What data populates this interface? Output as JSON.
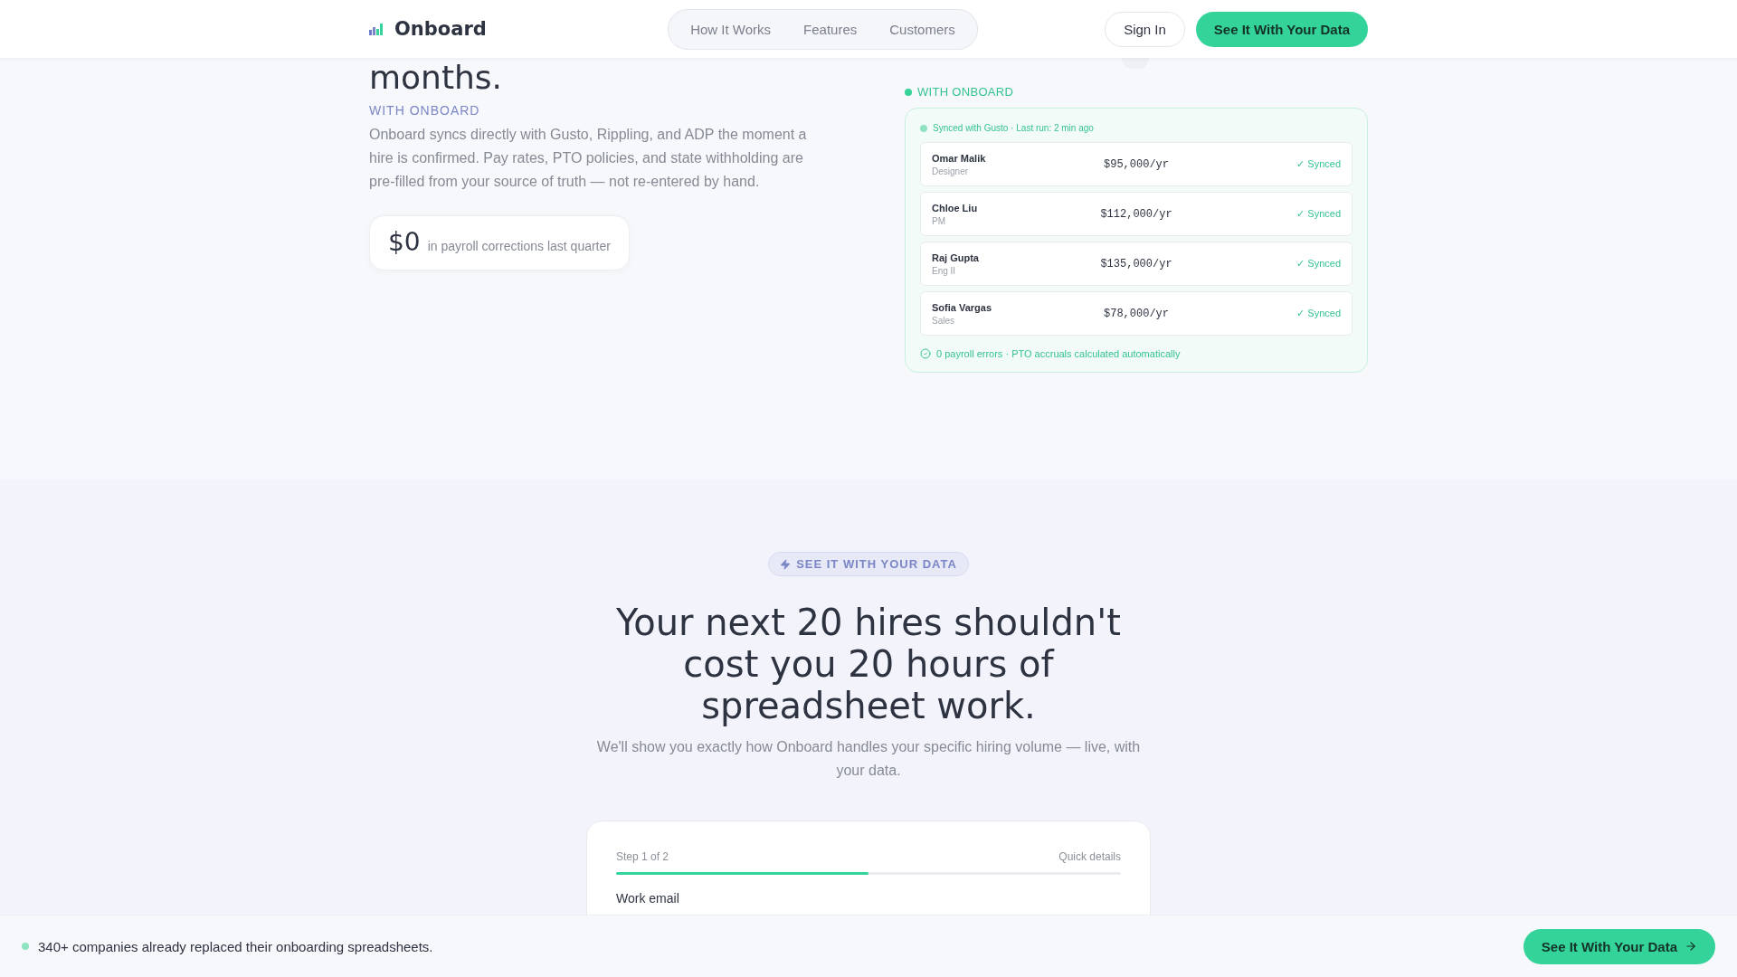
{
  "header": {
    "logo": "Onboard",
    "nav": [
      {
        "label": "How It Works"
      },
      {
        "label": "Features"
      },
      {
        "label": "Customers"
      }
    ],
    "sign_in": "Sign In",
    "cta": "See It With Your Data"
  },
  "comparison": {
    "heading_tail": "months.",
    "eyebrow": "WITH ONBOARD",
    "body": "Onboard syncs directly with Gusto, Rippling, and ADP the moment a hire is confirmed. Pay rates, PTO policies, and state withholding are pre-filled from your source of truth — not re-entered by hand.",
    "stat": {
      "value": "$0",
      "label": "in payroll corrections last quarter"
    },
    "panel": {
      "label": "WITH ONBOARD",
      "sync_status": "Synced with Gusto · Last run: 2 min ago",
      "rows": [
        {
          "name": "Omar Malik",
          "role": "Designer",
          "salary": "$95,000/yr",
          "status": "✓ Synced"
        },
        {
          "name": "Chloe Liu",
          "role": "PM",
          "salary": "$112,000/yr",
          "status": "✓ Synced"
        },
        {
          "name": "Raj Gupta",
          "role": "Eng II",
          "salary": "$135,000/yr",
          "status": "✓ Synced"
        },
        {
          "name": "Sofia Vargas",
          "role": "Sales",
          "salary": "$78,000/yr",
          "status": "✓ Synced"
        }
      ],
      "footer": "0 payroll errors · PTO accruals calculated automatically"
    }
  },
  "demo": {
    "badge": "SEE IT WITH YOUR DATA",
    "heading": "Your next 20 hires shouldn't cost you 20 hours of spreadsheet work.",
    "subtitle": "We'll show you exactly how Onboard handles your specific hiring volume — live, with your data.",
    "form": {
      "step": "Step 1 of 2",
      "step_title": "Quick details",
      "level": 0.5,
      "field_label": "Work email"
    }
  },
  "bottom_bar": {
    "text": "340+ companies already replaced their onboarding spreadsheets.",
    "cta": "See It With Your Data"
  }
}
